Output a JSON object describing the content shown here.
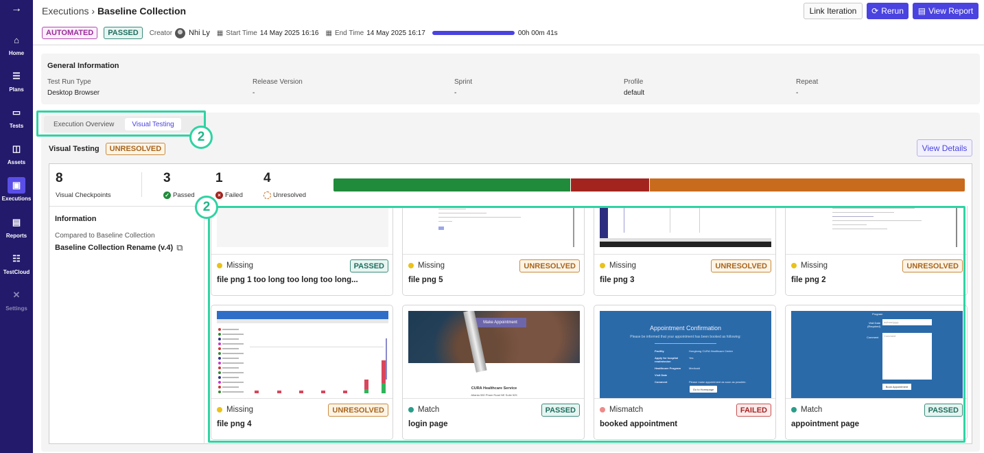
{
  "sidebar": {
    "items": [
      {
        "label": "Home",
        "icon": "home-icon",
        "glyph": "⌂"
      },
      {
        "label": "Plans",
        "icon": "checklist-icon",
        "glyph": "☰"
      },
      {
        "label": "Tests",
        "icon": "folder-icon",
        "glyph": "▭"
      },
      {
        "label": "Assets",
        "icon": "cubes-icon",
        "glyph": "◫"
      },
      {
        "label": "Executions",
        "icon": "executions-folder-icon",
        "glyph": "▣"
      },
      {
        "label": "Reports",
        "icon": "report-icon",
        "glyph": "▤"
      },
      {
        "label": "TestCloud",
        "icon": "server-icon",
        "glyph": "☷"
      },
      {
        "label": "Settings",
        "icon": "tools-icon",
        "glyph": "✕"
      }
    ],
    "top_glyph": "→"
  },
  "header": {
    "breadcrumb_parent": "Executions",
    "breadcrumb_sep": "›",
    "breadcrumb_current": "Baseline Collection",
    "link_iteration": "Link Iteration",
    "rerun": "Rerun",
    "view_report": "View Report",
    "badge_automated": "AUTOMATED",
    "badge_passed": "PASSED",
    "creator_label": "Creator",
    "creator_name": "Nhi Ly",
    "start_label": "Start Time",
    "start_value": "14 May 2025 16:16",
    "end_label": "End Time",
    "end_value": "14 May 2025 16:17",
    "duration": "00h 00m 41s",
    "progress": 1.0
  },
  "general": {
    "title": "General Information",
    "fields": [
      {
        "k": "Test Run Type",
        "v": "Desktop Browser"
      },
      {
        "k": "Release Version",
        "v": "-"
      },
      {
        "k": "Sprint",
        "v": "-"
      },
      {
        "k": "Profile",
        "v": "default"
      },
      {
        "k": "Repeat",
        "v": "-"
      }
    ]
  },
  "visual": {
    "tabs": [
      "Execution Overview",
      "Visual Testing"
    ],
    "active_tab": 1,
    "annotation": "2",
    "title": "Visual Testing",
    "status_badge": "UNRESOLVED",
    "view_details": "View Details",
    "stats": {
      "total": "8",
      "total_label": "Visual Checkpoints",
      "passed": "3",
      "passed_label": "Passed",
      "failed": "1",
      "failed_label": "Failed",
      "unresolved": "4",
      "unresolved_label": "Unresolved"
    },
    "bar": [
      {
        "value": 3,
        "color": "#218b3c"
      },
      {
        "value": 1,
        "color": "#a3241e"
      },
      {
        "value": 4,
        "color": "#c96b1c"
      }
    ],
    "info": {
      "title": "Information",
      "compared_label": "Compared to Baseline Collection",
      "baseline": "Baseline Collection Rename (v.4)"
    },
    "cards": [
      {
        "status": "Missing",
        "dot": "#e9c21c",
        "badge": "PASSED",
        "badge_type": "pass",
        "name": "file png 1 too long too long too long..."
      },
      {
        "status": "Missing",
        "dot": "#e9c21c",
        "badge": "UNRESOLVED",
        "badge_type": "unres",
        "name": "file png 5"
      },
      {
        "status": "Missing",
        "dot": "#e9c21c",
        "badge": "UNRESOLVED",
        "badge_type": "unres",
        "name": "file png 3"
      },
      {
        "status": "Missing",
        "dot": "#e9c21c",
        "badge": "UNRESOLVED",
        "badge_type": "unres",
        "name": "file png 2"
      },
      {
        "status": "Missing",
        "dot": "#e9c21c",
        "badge": "UNRESOLVED",
        "badge_type": "unres",
        "name": "file png 4"
      },
      {
        "status": "Match",
        "dot": "#2a9d8a",
        "badge": "PASSED",
        "badge_type": "pass",
        "name": "login page"
      },
      {
        "status": "Mismatch",
        "dot": "#ef8a8a",
        "badge": "FAILED",
        "badge_type": "fail",
        "name": "booked appointment"
      },
      {
        "status": "Match",
        "dot": "#2a9d8a",
        "badge": "PASSED",
        "badge_type": "pass",
        "name": "appointment page"
      }
    ],
    "thumbs": {
      "make_appointment": "Make Appointment",
      "cura": "CURA Healthcare Service",
      "address": "Atlanta 550 Pham Road NE Suite 525",
      "confirm_title": "Appointment Confirmation",
      "confirm_sub": "Please be informed that your appointment has been booked as following:",
      "confirm_rows": [
        [
          "Facility",
          "Hongkong CURA Healthcare Center"
        ],
        [
          "Apply for hospital readmission",
          "Yes"
        ],
        [
          "Healthcare Program",
          "Medicaid"
        ],
        [
          "Visit Date",
          ""
        ],
        [
          "Comment",
          "Please make appointment as soon as possible."
        ]
      ],
      "go_home": "Go to Homepage",
      "program": "Program",
      "visit_date": "Visit Date (Required)",
      "date_placeholder": "dd/mm/yyyy",
      "comment": "Comment",
      "comment_placeholder": "Comment",
      "book": "Book Appointment"
    }
  }
}
